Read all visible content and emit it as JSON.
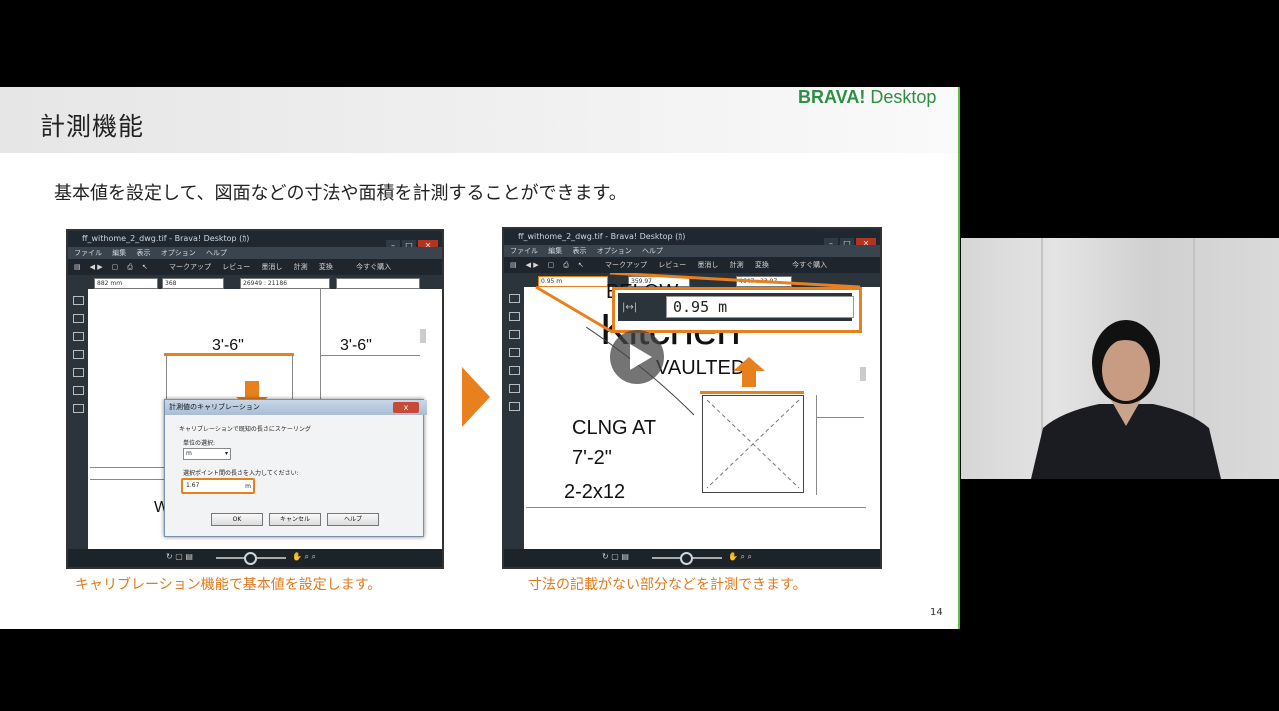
{
  "slide": {
    "title": "計測機能",
    "brand_bold": "BRAVA!",
    "brand_light": " Desktop",
    "subtitle": "基本値を設定して、図面などの寸法や面積を計測することができます。",
    "caption_left": "キャリブレーション機能で基本値を設定します。",
    "caption_right": "寸法の記載がない部分などを計測できます。",
    "page_number": "14"
  },
  "left_window": {
    "title": "ff_withome_2_dwg.tif - Brava! Desktop (ｶ)",
    "menu": [
      "ファイル",
      "編集",
      "表示",
      "オプション",
      "ヘルプ"
    ],
    "toolbar": [
      "マークアップ",
      "レビュー",
      "墨消し",
      "計測",
      "変換",
      "今すぐ購入"
    ],
    "fields": [
      "882 mm",
      "368",
      "26949 : 21186"
    ],
    "dims": [
      "3'-6\"",
      "3'-6\""
    ],
    "partial_text": "W",
    "dialog": {
      "title": "計測値のキャリブレーション",
      "close": "x",
      "instruction": "キャリブレーションで既知の長さにスケーリング",
      "unit_label": "単位の選択:",
      "unit_value": "m",
      "length_label": "選択ポイント間の長さを入力してください:",
      "length_value": "1.67",
      "length_unit": "m",
      "ok": "OK",
      "cancel": "キャンセル",
      "help": "ヘルプ"
    }
  },
  "right_window": {
    "title": "ff_withome_2_dwg.tif - Brava! Desktop (ｶ)",
    "menu": [
      "ファイル",
      "編集",
      "表示",
      "オプション",
      "ヘルプ"
    ],
    "toolbar": [
      "マークアップ",
      "レビュー",
      "墨消し",
      "計測",
      "変換",
      "今すぐ購入"
    ],
    "fields": [
      "0.95 m",
      "359.97",
      "4647 : 23.97"
    ],
    "zoom_value": "0.95  m",
    "plan_text": {
      "below": "BELOW",
      "kitchen": "Kitchen",
      "vaulted": "VAULTED",
      "clng": "CLNG AT",
      "height": "7'-2\"",
      "beam": "2-2x12"
    }
  },
  "colors": {
    "accent_orange": "#e8801e",
    "brand_green": "#2e8f44",
    "slide_border_green": "#57c13d"
  }
}
